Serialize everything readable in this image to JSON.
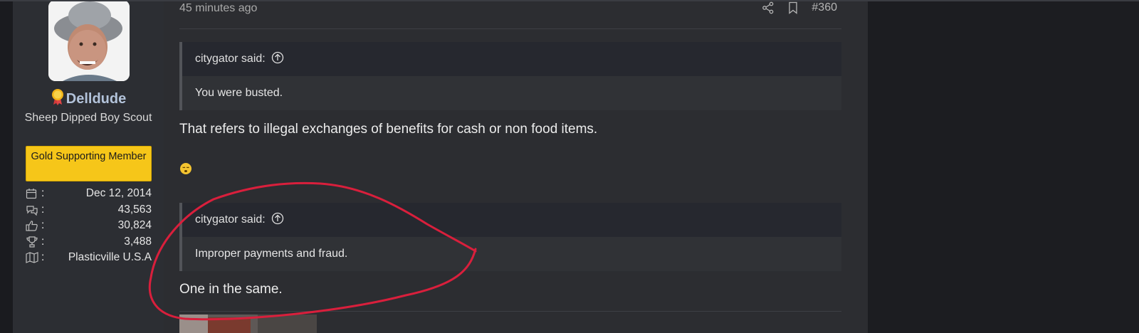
{
  "user": {
    "name": "Delldude",
    "title": "Sheep Dipped Boy Scout",
    "banner": "Gold Supporting Member",
    "stats": [
      {
        "icon": "calendar-icon",
        "value": "Dec 12, 2014"
      },
      {
        "icon": "messages-icon",
        "value": "43,563"
      },
      {
        "icon": "thumbs-up-icon",
        "value": "30,824"
      },
      {
        "icon": "trophy-icon",
        "value": "3,488"
      },
      {
        "icon": "map-icon",
        "value": "Plasticville U.S.A"
      }
    ],
    "colon": ":"
  },
  "post": {
    "time": "45 minutes ago",
    "number": "#360",
    "quote1": {
      "author": "citygator said:",
      "body": "You were busted."
    },
    "text1": "That refers to illegal exchanges of benefits for cash or non food items.",
    "quote2": {
      "author": "citygator said:",
      "body": "Improper payments and fraud."
    },
    "text2": "One in the same."
  },
  "colors": {
    "banner": "#f6c619",
    "username": "#b3c3da",
    "annotation": "#d91f3c"
  }
}
